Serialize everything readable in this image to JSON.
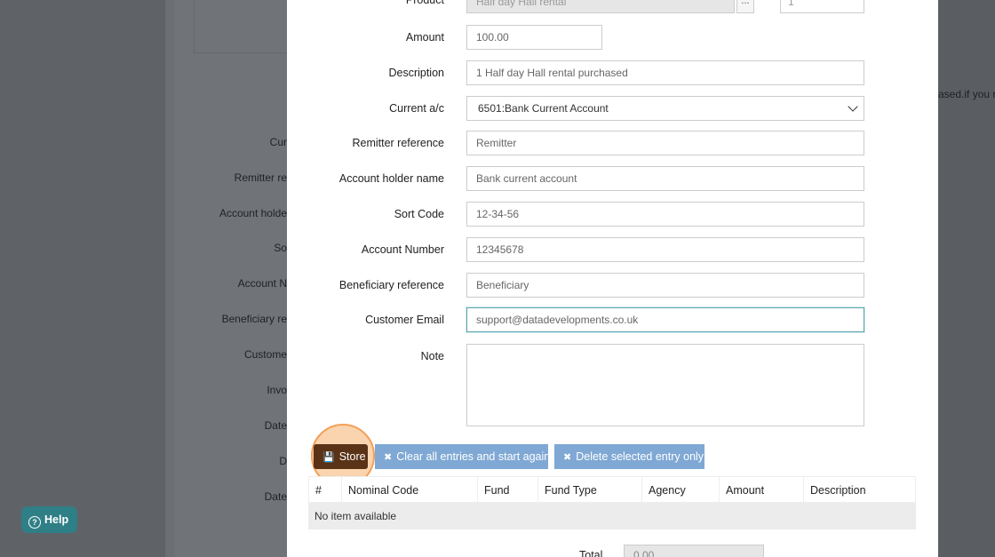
{
  "background": {
    "labels": [
      "Cur",
      "Remitter re",
      "Account holde",
      "So",
      "Account N",
      "Beneficiary re",
      "Custome",
      "Invo",
      "Date",
      "D",
      "Date"
    ],
    "right_text": "ased.if you r"
  },
  "form": {
    "product": {
      "label": "Product",
      "value": "Half day Hall rental",
      "ellipsis": "...",
      "qty": "1"
    },
    "amount": {
      "label": "Amount",
      "value": "100.00"
    },
    "description": {
      "label": "Description",
      "value": "1 Half day Hall rental purchased"
    },
    "current_ac": {
      "label": "Current a/c",
      "value": "6501:Bank Current Account"
    },
    "remitter_reference": {
      "label": "Remitter reference",
      "value": "Remitter"
    },
    "account_holder_name": {
      "label": "Account holder name",
      "value": "Bank current account"
    },
    "sort_code": {
      "label": "Sort Code",
      "value": "12-34-56"
    },
    "account_number": {
      "label": "Account Number",
      "value": "12345678"
    },
    "beneficiary_reference": {
      "label": "Beneficiary reference",
      "value": "Beneficiary"
    },
    "customer_email": {
      "label": "Customer Email",
      "value": "support@datadevelopments.co.uk"
    },
    "note": {
      "label": "Note",
      "value": ""
    }
  },
  "buttons": {
    "store": "Store",
    "clear": "Clear all entries and start again",
    "delete": "Delete selected entry only"
  },
  "table": {
    "headers": [
      "#",
      "Nominal Code",
      "Fund",
      "Fund Type",
      "Agency",
      "Amount",
      "Description"
    ],
    "empty_text": "No item available"
  },
  "total": {
    "label": "Total",
    "value": "0.00"
  },
  "help": {
    "label": "Help"
  },
  "colors": {
    "store": "#5a3215",
    "secondary": "#7fa8d4",
    "help": "#2f7f86",
    "highlight": "#f3a05a"
  }
}
